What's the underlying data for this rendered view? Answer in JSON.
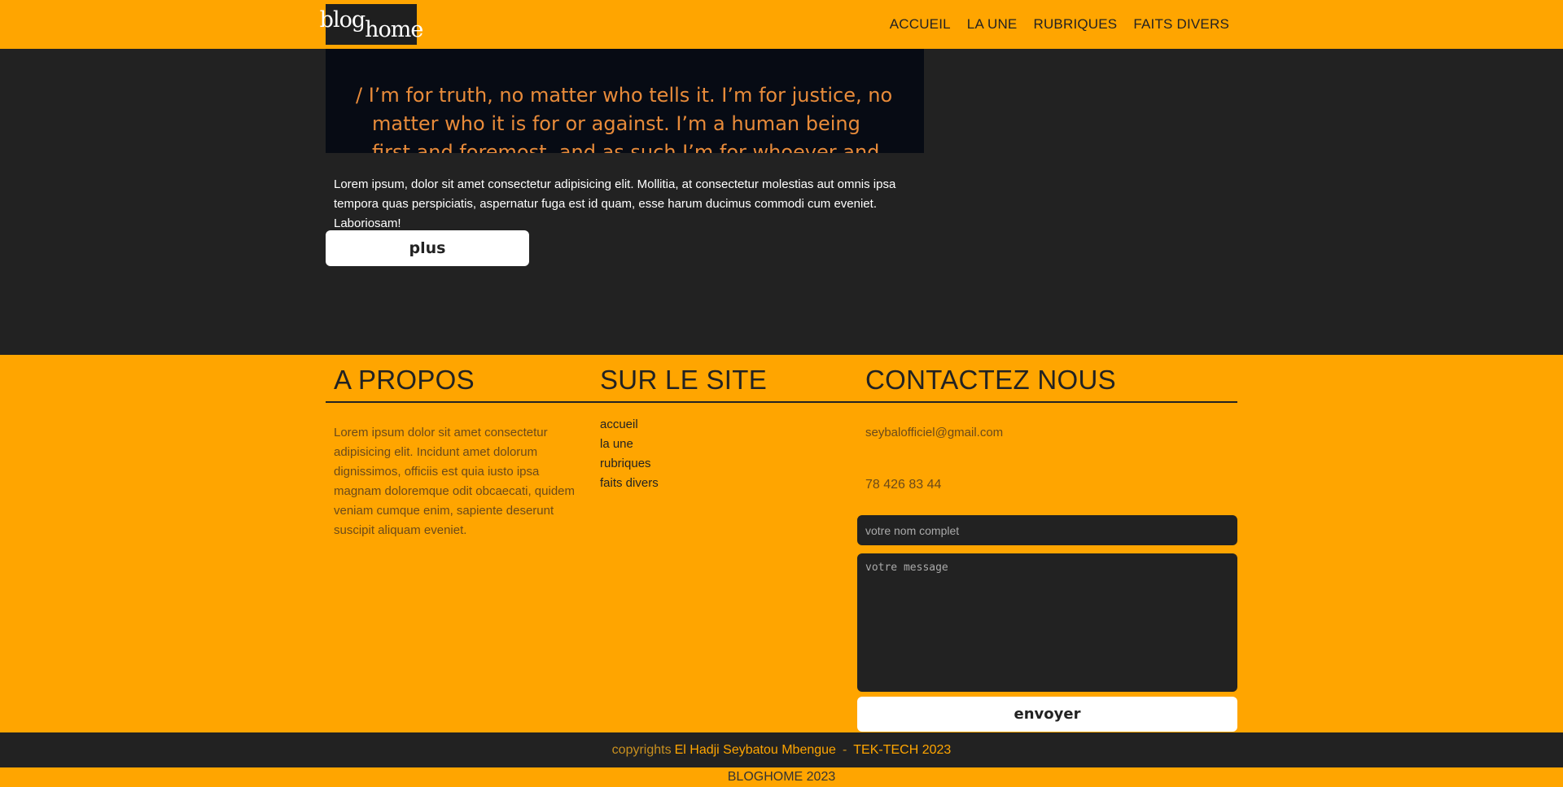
{
  "header": {
    "logo_text_1": "blog",
    "logo_text_2": "home",
    "nav": [
      "ACCUEIL",
      "LA UNE",
      "RUBRIQUES",
      "FAITS DIVERS"
    ]
  },
  "main": {
    "hero_quote_line1": "/ I’m for truth, no matter who tells it. I’m for justice, no",
    "hero_quote_line2": "matter who it is for or against. I’m a human being",
    "hero_quote_line3": "first and foremost, and as such I’m for whoever and",
    "text": "Lorem ipsum, dolor sit amet consectetur adipisicing elit. Mollitia, at consectetur molestias aut omnis ipsa tempora quas perspiciatis, aspernatur fuga est id quam, esse harum ducimus commodi cum eveniet. Laboriosam!",
    "more_label": "plus"
  },
  "footer": {
    "about_title": "A PROPOS",
    "about_text": "Lorem ipsum dolor sit amet consectetur adipisicing elit. Incidunt amet dolorum dignissimos, officiis est quia iusto ipsa magnam doloremque odit obcaecati, quidem veniam cumque enim, sapiente deserunt suscipit aliquam eveniet.",
    "site_title": "SUR LE SITE",
    "site_links": [
      "accueil",
      "la une",
      "rubriques",
      "faits divers"
    ],
    "contact_title": "CONTACTEZ NOUS",
    "email": "seybalofficiel@gmail.com",
    "phone": "78 426 83 44",
    "name_placeholder": "votre nom complet",
    "message_placeholder": "votre message",
    "send_label": "envoyer"
  },
  "copyright": {
    "prefix": "copyrights",
    "author": "El Hadji Seybatou Mbengue",
    "separator": "-",
    "company": "TEK-TECH 2023"
  },
  "bottom": {
    "text": "BLOGHOME 2023"
  },
  "colors": {
    "accent": "#FFA500",
    "dark": "#222222"
  }
}
